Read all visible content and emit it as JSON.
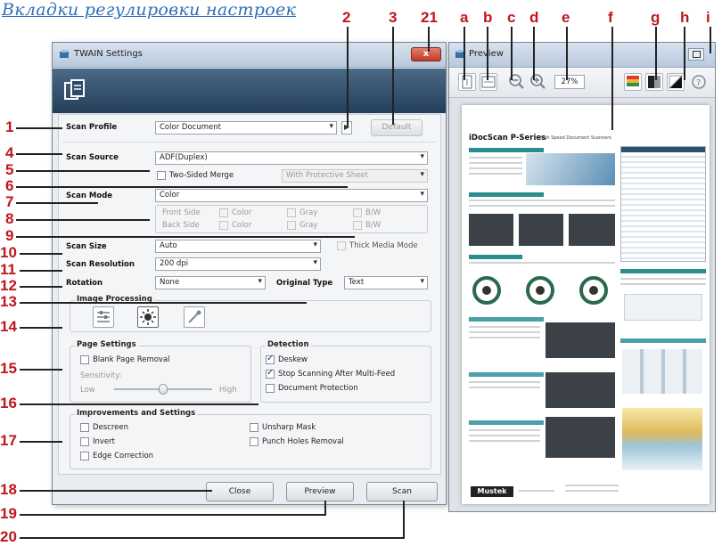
{
  "heading": "Вкладки регулировки настроек",
  "twain": {
    "title": "TWAIN Settings",
    "close_label": "x",
    "scan_profile": {
      "label": "Scan Profile",
      "value": "Color Document",
      "default_button": "Default"
    },
    "scan_source": {
      "label": "Scan Source",
      "value": "ADF(Duplex)"
    },
    "two_sided_merge": {
      "label": "Two-Sided Merge",
      "checked": false
    },
    "protective_sheet": {
      "value": "With Protective Sheet"
    },
    "scan_mode": {
      "label": "Scan Mode",
      "value": "Color"
    },
    "sides": {
      "front": "Front Side",
      "back": "Back Side",
      "options": [
        "Color",
        "Gray",
        "B/W"
      ]
    },
    "scan_size": {
      "label": "Scan Size",
      "value": "Auto"
    },
    "thick_media": {
      "label": "Thick Media Mode",
      "checked": false
    },
    "scan_resolution": {
      "label": "Scan Resolution",
      "value": "200 dpi"
    },
    "rotation": {
      "label": "Rotation",
      "value": "None"
    },
    "original_type": {
      "label": "Original Type",
      "value": "Text"
    },
    "image_processing": {
      "title": "Image Processing"
    },
    "page_settings": {
      "title": "Page Settings",
      "blank_page_removal": "Blank Page Removal",
      "sensitivity": "Sensitivity:",
      "low": "Low",
      "high": "High",
      "slider_level": 0.5
    },
    "detection": {
      "title": "Detection",
      "deskew": "Deskew",
      "stop_scanning": "Stop Scanning After Multi-Feed",
      "document_protection": "Document Protection"
    },
    "improvements": {
      "title": "Improvements and Settings",
      "descreen": "Descreen",
      "invert": "Invert",
      "edge_correction": "Edge Correction",
      "unsharp_mask": "Unsharp Mask",
      "punch_holes": "Punch Holes Removal"
    },
    "buttons": {
      "close": "Close",
      "preview": "Preview",
      "scan": "Scan"
    }
  },
  "preview": {
    "title": "Preview",
    "zoom": "27%",
    "doc": {
      "title": "iDocScan P-Series",
      "subtitle": "High Speed Document Scanners",
      "logo": "Mustek"
    }
  },
  "callouts": {
    "left": [
      "1",
      "4",
      "5",
      "6",
      "7",
      "8",
      "9",
      "10",
      "11",
      "12",
      "13",
      "14",
      "15",
      "16",
      "17",
      "18",
      "19",
      "20"
    ],
    "top": [
      "2",
      "3",
      "21",
      "a",
      "b",
      "c",
      "d",
      "e",
      "f",
      "g",
      "h",
      "i"
    ]
  },
  "colors": {
    "callout": "#c0161d",
    "heading": "#2e6fb8",
    "title_bar": "#b9cade"
  }
}
